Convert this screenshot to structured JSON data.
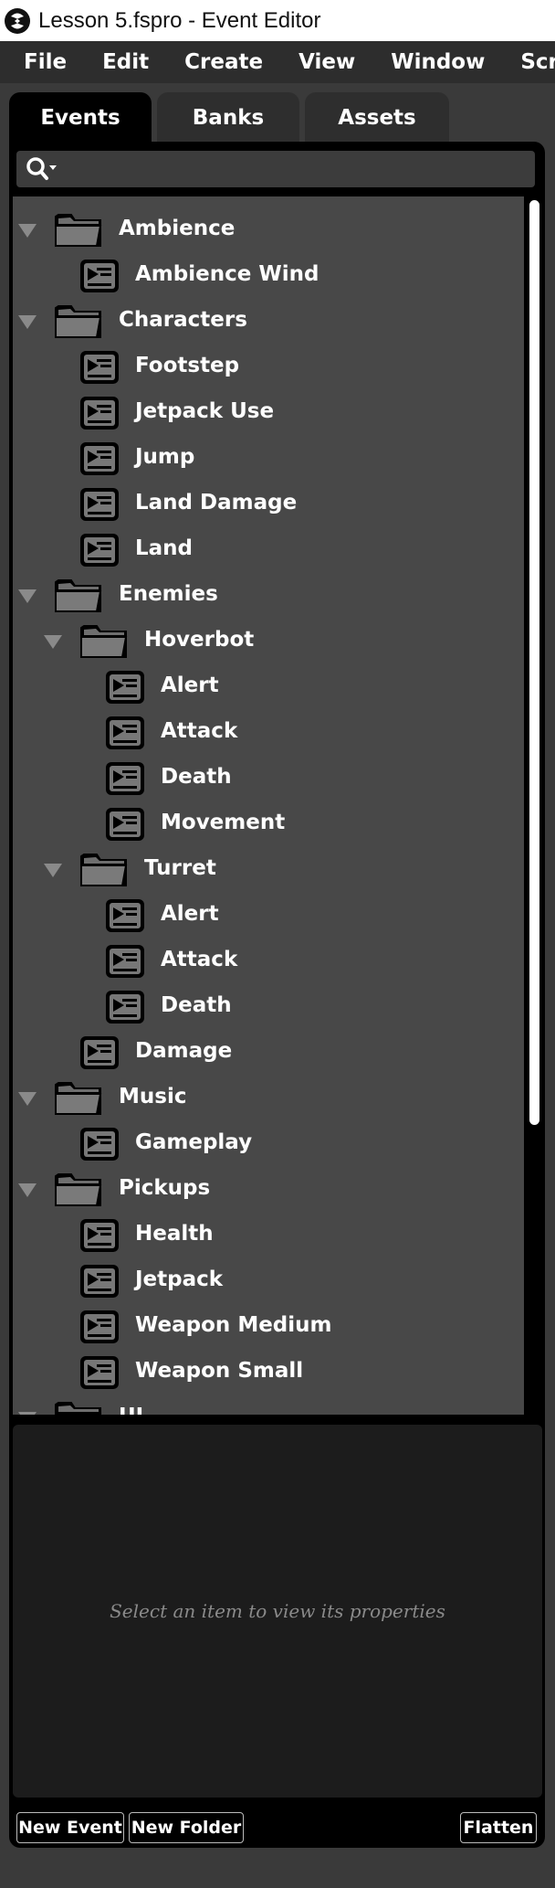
{
  "window": {
    "title": "Lesson 5.fspro - Event Editor"
  },
  "menu": [
    "File",
    "Edit",
    "Create",
    "View",
    "Window",
    "Scripts"
  ],
  "tabs": [
    "Events",
    "Banks",
    "Assets"
  ],
  "search": {
    "value": "",
    "placeholder": ""
  },
  "tree": [
    {
      "type": "folder",
      "depth": 0,
      "label": "Ambience",
      "expanded": true
    },
    {
      "type": "event",
      "depth": 1,
      "label": "Ambience Wind"
    },
    {
      "type": "folder",
      "depth": 0,
      "label": "Characters",
      "expanded": true
    },
    {
      "type": "event",
      "depth": 1,
      "label": "Footstep"
    },
    {
      "type": "event",
      "depth": 1,
      "label": "Jetpack Use"
    },
    {
      "type": "event",
      "depth": 1,
      "label": "Jump"
    },
    {
      "type": "event",
      "depth": 1,
      "label": "Land Damage"
    },
    {
      "type": "event",
      "depth": 1,
      "label": "Land"
    },
    {
      "type": "folder",
      "depth": 0,
      "label": "Enemies",
      "expanded": true
    },
    {
      "type": "folder",
      "depth": 1,
      "label": "Hoverbot",
      "expanded": true
    },
    {
      "type": "event",
      "depth": 2,
      "label": "Alert"
    },
    {
      "type": "event",
      "depth": 2,
      "label": "Attack"
    },
    {
      "type": "event",
      "depth": 2,
      "label": "Death"
    },
    {
      "type": "event",
      "depth": 2,
      "label": "Movement"
    },
    {
      "type": "folder",
      "depth": 1,
      "label": "Turret",
      "expanded": true
    },
    {
      "type": "event",
      "depth": 2,
      "label": "Alert"
    },
    {
      "type": "event",
      "depth": 2,
      "label": "Attack"
    },
    {
      "type": "event",
      "depth": 2,
      "label": "Death"
    },
    {
      "type": "event",
      "depth": 1,
      "label": "Damage"
    },
    {
      "type": "folder",
      "depth": 0,
      "label": "Music",
      "expanded": true
    },
    {
      "type": "event",
      "depth": 1,
      "label": "Gameplay"
    },
    {
      "type": "folder",
      "depth": 0,
      "label": "Pickups",
      "expanded": true
    },
    {
      "type": "event",
      "depth": 1,
      "label": "Health"
    },
    {
      "type": "event",
      "depth": 1,
      "label": "Jetpack"
    },
    {
      "type": "event",
      "depth": 1,
      "label": "Weapon Medium"
    },
    {
      "type": "event",
      "depth": 1,
      "label": "Weapon Small"
    },
    {
      "type": "folder",
      "depth": 0,
      "label": "UI",
      "expanded": true
    }
  ],
  "properties": {
    "hint": "Select an item to view its properties"
  },
  "buttons": {
    "new_event": "New Event",
    "new_folder": "New Folder",
    "flatten": "Flatten"
  },
  "colors": {
    "panel_bg": "#000000",
    "tree_bg": "#484848",
    "menubar_bg": "#2d2d2d"
  }
}
